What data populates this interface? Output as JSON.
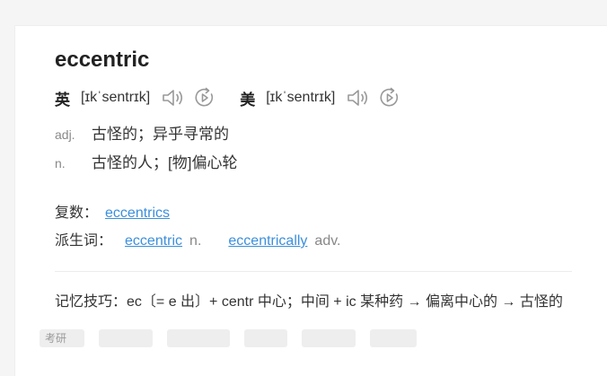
{
  "entry": {
    "word": "eccentric",
    "pronunciations": [
      {
        "region": "英",
        "phonetic": "[ɪkˈsentrɪk]"
      },
      {
        "region": "美",
        "phonetic": "[ɪkˈsentrɪk]"
      }
    ],
    "definitions": [
      {
        "pos": "adj.",
        "meaning": "古怪的；异乎寻常的"
      },
      {
        "pos": "n.",
        "meaning": "古怪的人；[物]偏心轮"
      }
    ],
    "plural": {
      "label": "复数：",
      "link": "eccentrics"
    },
    "derivatives": {
      "label": "派生词：",
      "items": [
        {
          "word": "eccentric",
          "pos": "n."
        },
        {
          "word": "eccentrically",
          "pos": "adv."
        }
      ]
    },
    "memory_tip": "记忆技巧：ec〔= e 出〕+ centr 中心；中间 + ic 某种药 → 偏离中心的 → 古怪的",
    "tags": [
      {
        "label": "考研"
      },
      {
        "label": ""
      },
      {
        "label": ""
      },
      {
        "label": ""
      },
      {
        "label": ""
      },
      {
        "label": ""
      }
    ]
  },
  "colors": {
    "link": "#3c8fdc",
    "muted": "#888888",
    "text": "#333333",
    "background": "#f5f5f5"
  },
  "icons": [
    "speaker-icon",
    "replay-icon"
  ]
}
